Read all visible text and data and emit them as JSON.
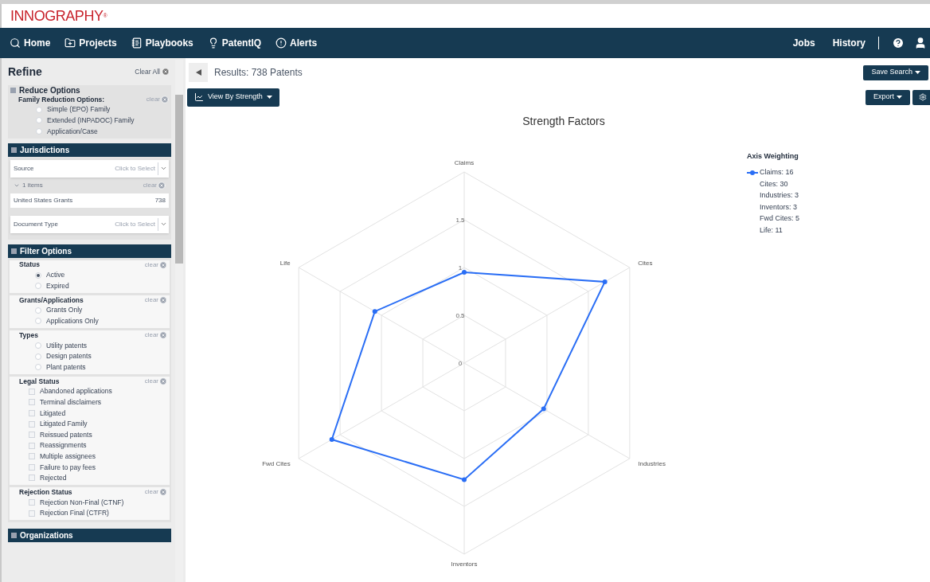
{
  "brand": {
    "logo": "INNOGRAPHY",
    "mark": "®"
  },
  "nav": {
    "items": [
      "Home",
      "Projects",
      "Playbooks",
      "PatentIQ",
      "Alerts"
    ],
    "right": [
      "Jobs",
      "History"
    ]
  },
  "sidebar": {
    "title": "Refine",
    "clear_all": "Clear All",
    "reduce": {
      "title": "Reduce Options",
      "group": "Family Reduction Options:",
      "clear": "clear",
      "options": [
        {
          "label": "Simple (EPO) Family",
          "selected": false
        },
        {
          "label": "Extended (INPADOC) Family",
          "selected": false
        },
        {
          "label": "Application/Case",
          "selected": false
        }
      ]
    },
    "jurisdictions": {
      "title": "Jurisdictions",
      "source": {
        "label": "Source",
        "placeholder": "Click to Select"
      },
      "items_count": "1 items",
      "clear": "clear",
      "item": {
        "label": "United States Grants",
        "count": "738"
      },
      "document_type": {
        "label": "Document Type",
        "placeholder": "Click to Select"
      }
    },
    "filter": {
      "title": "Filter Options",
      "groups": [
        {
          "title": "Status",
          "clear": "clear",
          "kind": "radio",
          "options": [
            {
              "label": "Active",
              "selected": true
            },
            {
              "label": "Expired",
              "selected": false
            }
          ]
        },
        {
          "title": "Grants/Applications",
          "clear": "clear",
          "kind": "radio",
          "options": [
            {
              "label": "Grants Only",
              "selected": false
            },
            {
              "label": "Applications Only",
              "selected": false
            }
          ]
        },
        {
          "title": "Types",
          "clear": "clear",
          "kind": "radio",
          "options": [
            {
              "label": "Utility patents",
              "selected": false
            },
            {
              "label": "Design patents",
              "selected": false
            },
            {
              "label": "Plant patents",
              "selected": false
            }
          ]
        },
        {
          "title": "Legal Status",
          "clear": "clear",
          "kind": "checkbox",
          "options": [
            {
              "label": "Abandoned applications",
              "selected": false
            },
            {
              "label": "Terminal disclaimers",
              "selected": false
            },
            {
              "label": "Litigated",
              "selected": false
            },
            {
              "label": "Litigated Family",
              "selected": false
            },
            {
              "label": "Reissued patents",
              "selected": false
            },
            {
              "label": "Reassignments",
              "selected": false
            },
            {
              "label": "Multiple assignees",
              "selected": false
            },
            {
              "label": "Failure to pay fees",
              "selected": false
            },
            {
              "label": "Rejected",
              "selected": false
            }
          ]
        },
        {
          "title": "Rejection Status",
          "clear": "clear",
          "kind": "checkbox",
          "options": [
            {
              "label": "Rejection Non-Final (CTNF)",
              "selected": false
            },
            {
              "label": "Rejection Final (CTFR)",
              "selected": false
            }
          ]
        }
      ]
    },
    "organizations": {
      "title": "Organizations"
    }
  },
  "results": {
    "text": "Results: 738 Patents",
    "view_button": "View By Strength",
    "save_button": "Save Search",
    "export_button": "Export"
  },
  "chart": {
    "title": "Strength Factors",
    "axes": [
      "Claims",
      "Cites",
      "Industries",
      "Inventors",
      "Fwd Cites",
      "Life"
    ],
    "tick_labels": [
      "1.5",
      "1",
      "0.5",
      "0"
    ],
    "legend": {
      "title": "Axis Weighting",
      "items": [
        "Claims: 16",
        "Cites: 30",
        "Industries: 3",
        "Inventors: 3",
        "Fwd Cites: 5",
        "Life: 11"
      ]
    }
  }
}
